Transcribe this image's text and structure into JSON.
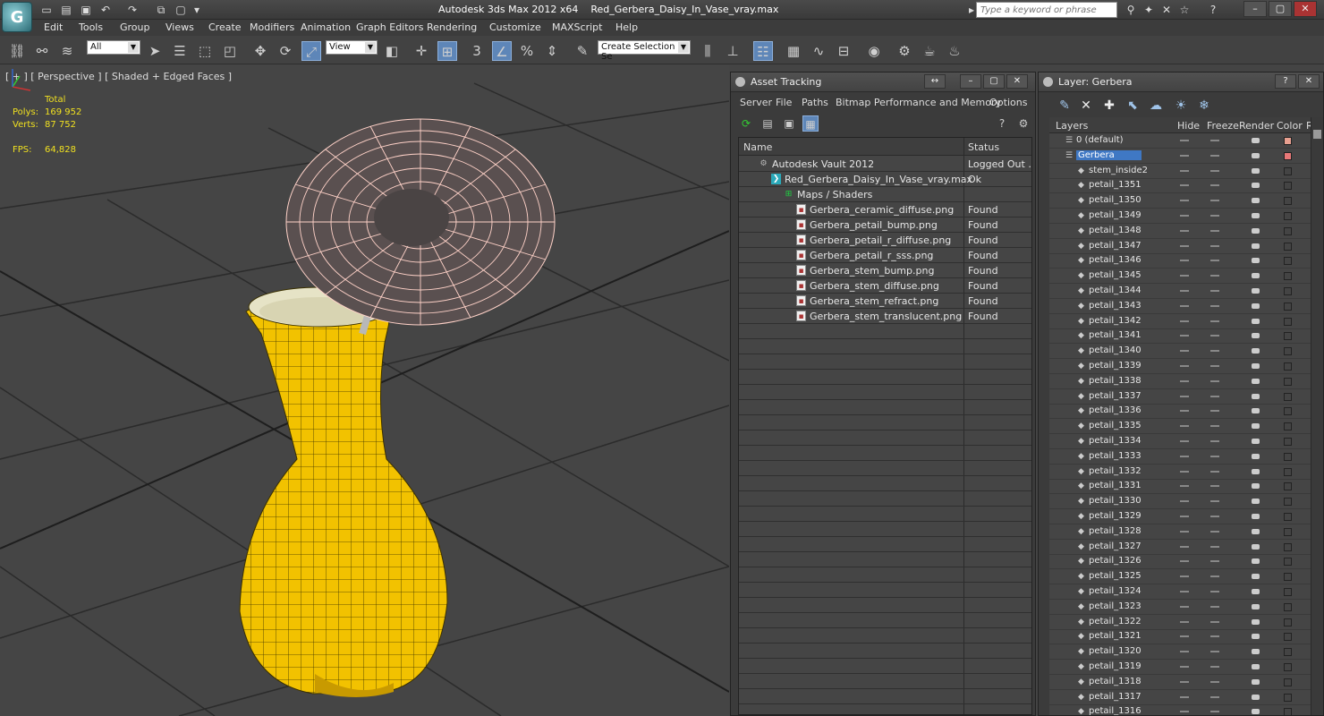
{
  "title_bar": {
    "app_name": "Autodesk 3ds Max  2012 x64",
    "file_name": "Red_Gerbera_Daisy_In_Vase_vray.max",
    "search_placeholder": "Type a keyword or phrase",
    "icons": [
      "new-icon",
      "open-icon",
      "save-icon",
      "undo-icon",
      "redo-icon",
      "project-icon",
      "dropdown-icon"
    ]
  },
  "menu": [
    "Edit",
    "Tools",
    "Group",
    "Views",
    "Create",
    "Modifiers",
    "Animation",
    "Graph Editors",
    "Rendering",
    "Customize",
    "MAXScript",
    "Help"
  ],
  "toolbar": {
    "selection_filter": "All",
    "reference_coord": "View",
    "selection_set_placeholder": "Create Selection Se",
    "snap_label": "3",
    "percent_label": "%"
  },
  "viewport": {
    "label": "[ + ] [ Perspective ] [ Shaded + Edged Faces ]",
    "stats_header": "Total",
    "polys_label": "Polys:",
    "polys_value": "169 952",
    "verts_label": "Verts:",
    "verts_value": "87 752",
    "fps_label": "FPS:",
    "fps_value": "64,828",
    "colors": {
      "vase": "#f2c200",
      "vase_wire": "#3a3000",
      "flower_wire": "#ffd2c8",
      "grid": "#2a2a2a",
      "background": "#454545"
    }
  },
  "asset_tracking": {
    "title": "Asset Tracking",
    "menu": [
      "Server",
      "File",
      "Paths",
      "Bitmap Performance and Memory",
      "Options"
    ],
    "columns": {
      "name": "Name",
      "status": "Status"
    },
    "rows": [
      {
        "name": "Autodesk Vault 2012",
        "status": "Logged Out ...",
        "icon": "vault-icon",
        "indent": 0
      },
      {
        "name": "Red_Gerbera_Daisy_In_Vase_vray.max",
        "status": "Ok",
        "icon": "max-file-icon",
        "indent": 1
      },
      {
        "name": "Maps / Shaders",
        "status": "",
        "icon": "maps-folder-icon",
        "indent": 2
      },
      {
        "name": "Gerbera_ceramic_diffuse.png",
        "status": "Found",
        "icon": "png-file-icon",
        "indent": 3
      },
      {
        "name": "Gerbera_petail_bump.png",
        "status": "Found",
        "icon": "png-file-icon",
        "indent": 3
      },
      {
        "name": "Gerbera_petail_r_diffuse.png",
        "status": "Found",
        "icon": "png-file-icon",
        "indent": 3
      },
      {
        "name": "Gerbera_petail_r_sss.png",
        "status": "Found",
        "icon": "png-file-icon",
        "indent": 3
      },
      {
        "name": "Gerbera_stem_bump.png",
        "status": "Found",
        "icon": "png-file-icon",
        "indent": 3
      },
      {
        "name": "Gerbera_stem_diffuse.png",
        "status": "Found",
        "icon": "png-file-icon",
        "indent": 3
      },
      {
        "name": "Gerbera_stem_refract.png",
        "status": "Found",
        "icon": "png-file-icon",
        "indent": 3
      },
      {
        "name": "Gerbera_stem_translucent.png",
        "status": "Found",
        "icon": "png-file-icon",
        "indent": 3
      }
    ]
  },
  "layer_manager": {
    "title": "Layer: Gerbera",
    "columns": {
      "layers": "Layers",
      "hide": "Hide",
      "freeze": "Freeze",
      "render": "Render",
      "color": "Color",
      "extra": "R"
    },
    "layers": [
      {
        "name": "0 (default)",
        "indent": 0,
        "color": "#e8a090",
        "selected": false
      },
      {
        "name": "Gerbera",
        "indent": 0,
        "color": "#e87878",
        "selected": true
      },
      {
        "name": "stem_inside2",
        "indent": 1,
        "color": "#444444",
        "selected": false
      },
      {
        "name": "petail_1351",
        "indent": 1
      },
      {
        "name": "petail_1350",
        "indent": 1
      },
      {
        "name": "petail_1349",
        "indent": 1
      },
      {
        "name": "petail_1348",
        "indent": 1
      },
      {
        "name": "petail_1347",
        "indent": 1
      },
      {
        "name": "petail_1346",
        "indent": 1
      },
      {
        "name": "petail_1345",
        "indent": 1
      },
      {
        "name": "petail_1344",
        "indent": 1
      },
      {
        "name": "petail_1343",
        "indent": 1
      },
      {
        "name": "petail_1342",
        "indent": 1
      },
      {
        "name": "petail_1341",
        "indent": 1
      },
      {
        "name": "petail_1340",
        "indent": 1
      },
      {
        "name": "petail_1339",
        "indent": 1
      },
      {
        "name": "petail_1338",
        "indent": 1
      },
      {
        "name": "petail_1337",
        "indent": 1
      },
      {
        "name": "petail_1336",
        "indent": 1
      },
      {
        "name": "petail_1335",
        "indent": 1
      },
      {
        "name": "petail_1334",
        "indent": 1
      },
      {
        "name": "petail_1333",
        "indent": 1
      },
      {
        "name": "petail_1332",
        "indent": 1
      },
      {
        "name": "petail_1331",
        "indent": 1
      },
      {
        "name": "petail_1330",
        "indent": 1
      },
      {
        "name": "petail_1329",
        "indent": 1
      },
      {
        "name": "petail_1328",
        "indent": 1
      },
      {
        "name": "petail_1327",
        "indent": 1
      },
      {
        "name": "petail_1326",
        "indent": 1
      },
      {
        "name": "petail_1325",
        "indent": 1
      },
      {
        "name": "petail_1324",
        "indent": 1
      },
      {
        "name": "petail_1323",
        "indent": 1
      },
      {
        "name": "petail_1322",
        "indent": 1
      },
      {
        "name": "petail_1321",
        "indent": 1
      },
      {
        "name": "petail_1320",
        "indent": 1
      },
      {
        "name": "petail_1319",
        "indent": 1
      },
      {
        "name": "petail_1318",
        "indent": 1
      },
      {
        "name": "petail_1317",
        "indent": 1
      },
      {
        "name": "petail_1316",
        "indent": 1
      }
    ]
  }
}
